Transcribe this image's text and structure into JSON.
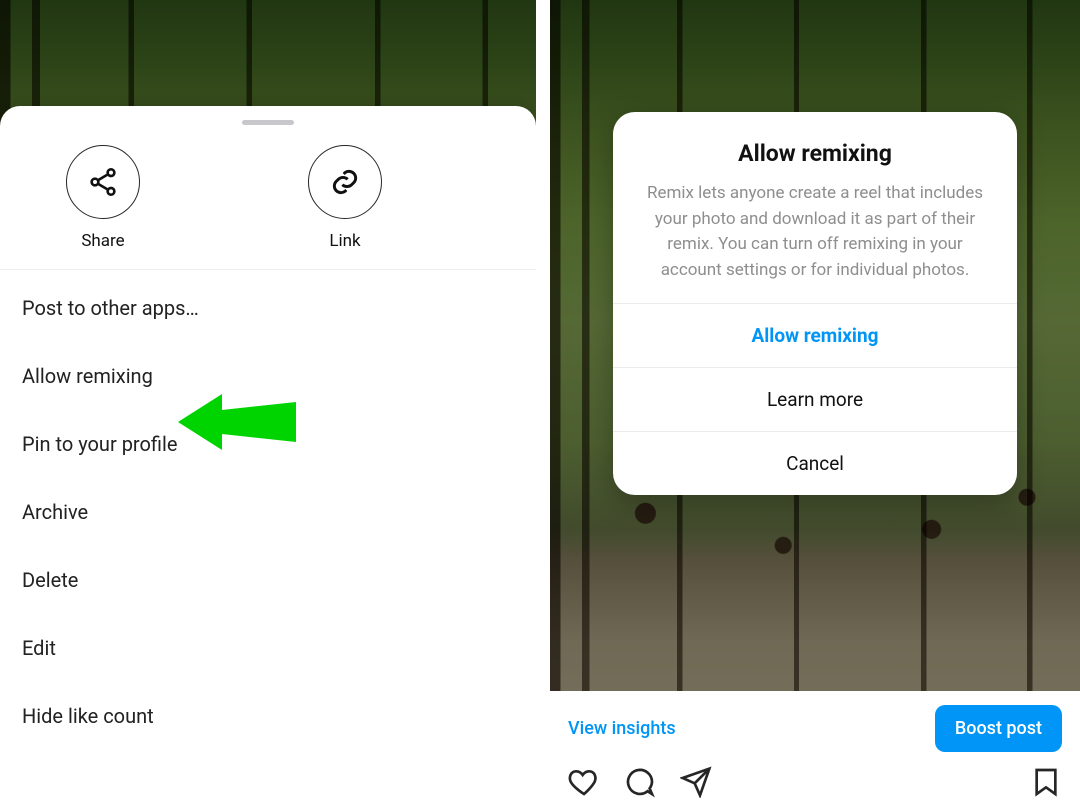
{
  "left": {
    "sheet": {
      "icon_buttons": {
        "share": {
          "label": "Share"
        },
        "link": {
          "label": "Link"
        }
      },
      "menu": [
        "Post to other apps…",
        "Allow remixing",
        "Pin to your profile",
        "Archive",
        "Delete",
        "Edit",
        "Hide like count"
      ]
    },
    "annotation": {
      "arrow_color": "#00d400",
      "targets_menu_index": 1
    }
  },
  "right": {
    "dialog": {
      "title": "Allow remixing",
      "body": "Remix lets anyone create a reel that includes your photo and download it as part of their remix. You can turn off remixing in your account settings or for individual photos.",
      "buttons": {
        "primary": "Allow remixing",
        "learn": "Learn more",
        "cancel": "Cancel"
      },
      "primary_color": "#0095f6"
    },
    "post_footer": {
      "insights_label": "View insights",
      "boost_label": "Boost post"
    }
  }
}
